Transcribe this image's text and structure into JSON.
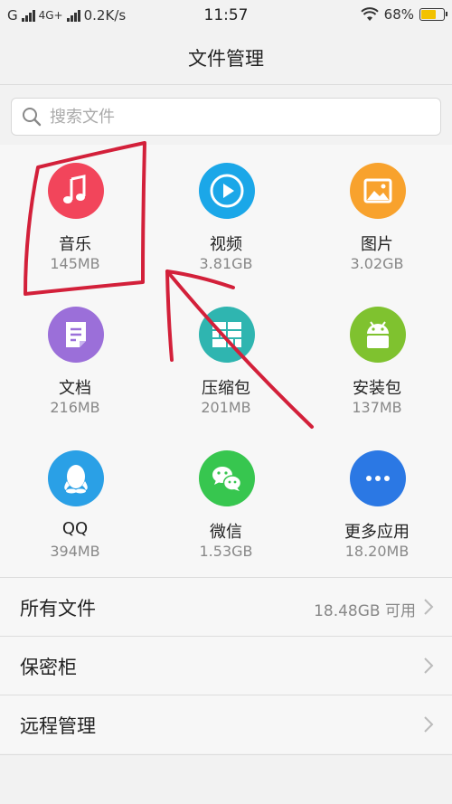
{
  "status_bar": {
    "carrier1": "G",
    "carrier2": "4G+",
    "speed": "0.2K/s",
    "time": "11:57",
    "battery": "68%",
    "battery_level": 0.68
  },
  "header": {
    "title": "文件管理"
  },
  "search": {
    "placeholder": "搜索文件"
  },
  "categories": [
    {
      "name": "音乐",
      "size": "145MB",
      "icon": "music-icon",
      "color": "#f2455b"
    },
    {
      "name": "视频",
      "size": "3.81GB",
      "icon": "video-icon",
      "color": "#1ba7e8"
    },
    {
      "name": "图片",
      "size": "3.02GB",
      "icon": "image-icon",
      "color": "#f8a22d"
    },
    {
      "name": "文档",
      "size": "216MB",
      "icon": "document-icon",
      "color": "#9b6fd9"
    },
    {
      "name": "压缩包",
      "size": "201MB",
      "icon": "archive-icon",
      "color": "#2fb5b0"
    },
    {
      "name": "安装包",
      "size": "137MB",
      "icon": "android-icon",
      "color": "#7fc22f"
    },
    {
      "name": "QQ",
      "size": "394MB",
      "icon": "qq-icon",
      "color": "#2aa0e6"
    },
    {
      "name": "微信",
      "size": "1.53GB",
      "icon": "wechat-icon",
      "color": "#37c64f"
    },
    {
      "name": "更多应用",
      "size": "18.20MB",
      "icon": "more-icon",
      "color": "#2b78e4"
    }
  ],
  "list": [
    {
      "label": "所有文件",
      "value": "18.48GB 可用"
    },
    {
      "label": "保密柜",
      "value": ""
    },
    {
      "label": "远程管理",
      "value": ""
    }
  ],
  "annotation_color": "#d3203a"
}
